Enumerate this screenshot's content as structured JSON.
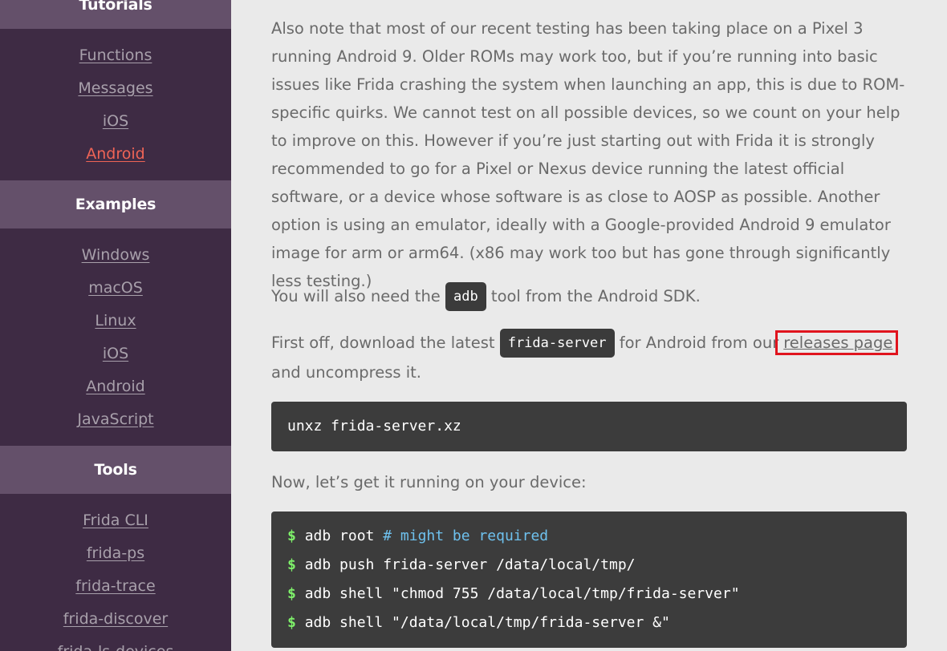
{
  "sidebar": {
    "sections": [
      {
        "title": "Tutorials",
        "items": [
          {
            "label": "Functions"
          },
          {
            "label": "Messages"
          },
          {
            "label": "iOS"
          },
          {
            "label": "Android",
            "active": true
          }
        ]
      },
      {
        "title": "Examples",
        "items": [
          {
            "label": "Windows"
          },
          {
            "label": "macOS"
          },
          {
            "label": "Linux"
          },
          {
            "label": "iOS"
          },
          {
            "label": "Android"
          },
          {
            "label": "JavaScript"
          }
        ]
      },
      {
        "title": "Tools",
        "items": [
          {
            "label": "Frida CLI"
          },
          {
            "label": "frida-ps"
          },
          {
            "label": "frida-trace"
          },
          {
            "label": "frida-discover"
          },
          {
            "label": "frida-ls-devices"
          }
        ]
      }
    ]
  },
  "content": {
    "intro_paragraph": "Also note that most of our recent testing has been taking place on a Pixel 3 running Android 9. Older ROMs may work too, but if you’re running into basic issues like Frida crashing the system when launching an app, this is due to ROM-specific quirks. We cannot test on all possible devices, so we count on your help to improve on this. However if you’re just starting out with Frida it is strongly recommended to go for a Pixel or Nexus device running the latest official software, or a device whose software is as close to AOSP as possible. Another option is using an emulator, ideally with a Google-provided Android 9 emulator image for arm or arm64. (x86 may work too but has gone through significantly less testing.)",
    "adb_para": {
      "before": "You will also need the ",
      "code": "adb",
      "after": " tool from the Android SDK."
    },
    "download_para": {
      "before": "First off, download the latest ",
      "code": "frida-server",
      "middle": " for Android from our",
      "link": "releases page",
      "after": "and uncompress it."
    },
    "unxz_code": "unxz frida-server.xz",
    "run_para": "Now, let’s get it running on your device:",
    "run_code": {
      "prompt": "$",
      "lines": [
        {
          "cmd": "adb root ",
          "comment": "# might be required"
        },
        {
          "cmd": "adb push frida-server /data/local/tmp/",
          "comment": ""
        },
        {
          "cmd": "adb shell \"chmod 755 /data/local/tmp/frida-server\"",
          "comment": ""
        },
        {
          "cmd": "adb shell \"/data/local/tmp/frida-server &\"",
          "comment": ""
        }
      ]
    }
  },
  "colors": {
    "sidebar_bg": "#3e2b44",
    "section_header_bg": "#64506a",
    "active_link": "#ef6456",
    "highlight_box": "#e0141e",
    "code_bg": "#3c3c3c",
    "prompt": "#7ef06a",
    "comment": "#6ec1ee"
  }
}
